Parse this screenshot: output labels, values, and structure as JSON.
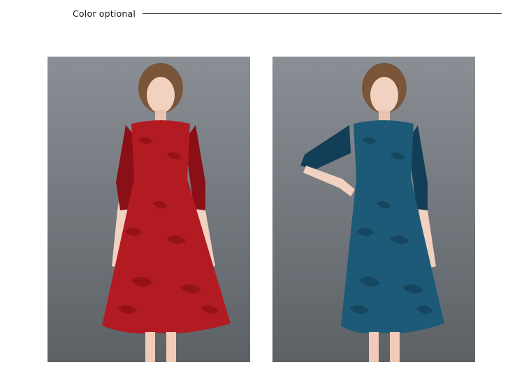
{
  "header": {
    "title": "Color optional"
  },
  "products": [
    {
      "color_name": "red",
      "dress_color": "#b31b22",
      "dress_shade": "#8a0f16"
    },
    {
      "color_name": "blue",
      "dress_color": "#1d5a78",
      "dress_shade": "#123f57"
    }
  ],
  "colors": {
    "backdrop": "#6f7479",
    "backdrop_light": "#8b9096",
    "skin": "#f1d2c0",
    "hair": "#7a5538"
  }
}
